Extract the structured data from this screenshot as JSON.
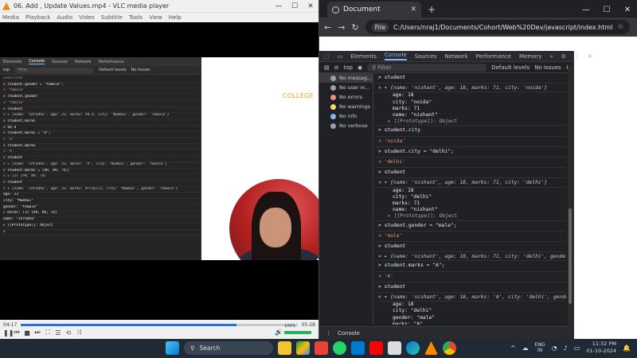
{
  "vlc": {
    "title": "06. Add , Update Values.mp4 - VLC media player",
    "menu": [
      "Media",
      "Playback",
      "Audio",
      "Video",
      "Subtitle",
      "Tools",
      "View",
      "Help"
    ],
    "time_elapsed": "04:17",
    "time_total": "05:28",
    "progress": 0.78,
    "volume_label": "100%",
    "volume": 1.0
  },
  "video_devtools": {
    "tabs": [
      "Elements",
      "Console",
      "Sources",
      "Network",
      "Performance"
    ],
    "context": "top",
    "filter_placeholder": "Filter",
    "levels": "Default levels",
    "issues": "No Issues",
    "lines": [
      {
        "t": "undefined",
        "k": "dim"
      },
      {
        "t": "> student.gender = \"female\";",
        "k": "in"
      },
      {
        "t": "< 'female'",
        "k": "str"
      },
      {
        "t": "> student.gender",
        "k": "in"
      },
      {
        "t": "< 'female'",
        "k": "str"
      },
      {
        "t": "> student",
        "k": "in"
      },
      {
        "t": "< ▸ {name: 'shradha', age: 23, marks: 94.4, city: 'Mumbai', gender: 'female'}",
        "k": "obj"
      },
      {
        "t": "> student.marks",
        "k": "in"
      },
      {
        "t": "< 94.4",
        "k": "in"
      },
      {
        "t": "> student.marks = \"A\";",
        "k": "in"
      },
      {
        "t": "< 'A'",
        "k": "str"
      },
      {
        "t": "> student.marks",
        "k": "in"
      },
      {
        "t": "< 'A'",
        "k": "str"
      },
      {
        "t": "> student",
        "k": "in"
      },
      {
        "t": "< ▸ {name: 'shradha', age: 23, marks: 'A', city: 'Mumbai', gender: 'female'}",
        "k": "obj"
      },
      {
        "t": "> student.marks = [99, 89, 74];",
        "k": "in"
      },
      {
        "t": "< ▸ (3) [99, 89, 74]",
        "k": "obj"
      },
      {
        "t": "> student",
        "k": "in"
      },
      {
        "t": "< ▾ {name: 'shradha', age: 23, marks: Array(3), city: 'Mumbai', gender: 'female'}",
        "k": "obj"
      },
      {
        "t": "      age: 23",
        "k": "in"
      },
      {
        "t": "      city: \"Mumbai\"",
        "k": "in"
      },
      {
        "t": "      gender: \"female\"",
        "k": "in"
      },
      {
        "t": "    ▸ marks: (3) [99, 89, 74]",
        "k": "in"
      },
      {
        "t": "      name: \"shradha\"",
        "k": "in"
      },
      {
        "t": "    ▸ [[Prototype]]: Object",
        "k": "in"
      },
      {
        "t": ">",
        "k": "in"
      }
    ]
  },
  "slide": {
    "brand": "COLLEGE"
  },
  "chrome": {
    "tab_title": "Document",
    "url_chip": "File",
    "url": "C:/Users/nraj1/Documents/Cohort/Web%20Dev/javascript/index.html",
    "devtools_tabs": [
      "Elements",
      "Console",
      "Sources",
      "Network",
      "Performance",
      "Memory"
    ],
    "context": "top",
    "filter_placeholder": "Filter",
    "levels": "Default levels",
    "issues": "No Issues",
    "sidebar": [
      {
        "label": "No messag...",
        "color": "#9aa0a6",
        "selected": true
      },
      {
        "label": "No user m...",
        "color": "#9aa0a6",
        "selected": false
      },
      {
        "label": "No errors",
        "color": "#f28b82",
        "selected": false
      },
      {
        "label": "No warnings",
        "color": "#fdd663",
        "selected": false
      },
      {
        "label": "No info",
        "color": "#8ab4f8",
        "selected": false
      },
      {
        "label": "No verbose",
        "color": "#9aa0a6",
        "selected": false
      }
    ],
    "console": [
      {
        "t": "> student",
        "k": "in"
      },
      {
        "t": "< ▾ {name: 'nishant', age: 18, marks: 71, city: 'noida'}",
        "k": "obj"
      },
      {
        "t": "age: 18",
        "k": "prop"
      },
      {
        "t": "city: \"noida\"",
        "k": "prop"
      },
      {
        "t": "marks: 71",
        "k": "prop"
      },
      {
        "t": "name: \"nishant\"",
        "k": "prop"
      },
      {
        "t": "▸ [[Prototype]]: Object",
        "k": "proto"
      },
      {
        "t": "> student.city",
        "k": "in"
      },
      {
        "t": "< 'noida'",
        "k": "str"
      },
      {
        "t": "> student.city = \"delhi\";",
        "k": "in"
      },
      {
        "t": "< 'delhi'",
        "k": "str"
      },
      {
        "t": "> student",
        "k": "in"
      },
      {
        "t": "< ▾ {name: 'nishant', age: 18, marks: 71, city: 'delhi'}",
        "k": "obj"
      },
      {
        "t": "age: 18",
        "k": "prop"
      },
      {
        "t": "city: \"delhi\"",
        "k": "prop"
      },
      {
        "t": "marks: 71",
        "k": "prop"
      },
      {
        "t": "name: \"nishant\"",
        "k": "prop"
      },
      {
        "t": "▸ [[Prototype]]: Object",
        "k": "proto"
      },
      {
        "t": "> student.gender = \"male\";",
        "k": "in"
      },
      {
        "t": "< 'male'",
        "k": "str"
      },
      {
        "t": "> student",
        "k": "in"
      },
      {
        "t": "< ▸ {name: 'nishant', age: 18, marks: 71, city: 'delhi', gender: 'male'}",
        "k": "obj"
      },
      {
        "t": "> student.marks = \"A\";",
        "k": "in"
      },
      {
        "t": "< 'A'",
        "k": "str"
      },
      {
        "t": "> student",
        "k": "in"
      },
      {
        "t": "< ▾ {name: 'nishant', age: 18, marks: 'A', city: 'delhi', gender: 'male'}",
        "k": "obj"
      },
      {
        "t": "age: 18",
        "k": "prop"
      },
      {
        "t": "city: \"delhi\"",
        "k": "prop"
      },
      {
        "t": "gender: \"male\"",
        "k": "prop"
      },
      {
        "t": "marks: \"A\"",
        "k": "prop"
      }
    ],
    "drawer_tab": "Console"
  },
  "taskbar": {
    "search_label": "Search",
    "lang_top": "ENG",
    "lang_bottom": "IN",
    "time": "11:32 PM",
    "date": "01-10-2024",
    "apps": [
      "windows-icon",
      "files-icon",
      "drive-icon",
      "gmail-icon",
      "whatsapp-icon",
      "vscode-icon",
      "youtube-icon",
      "app-icon",
      "edge-icon",
      "vlc-icon",
      "chrome-icon"
    ]
  }
}
